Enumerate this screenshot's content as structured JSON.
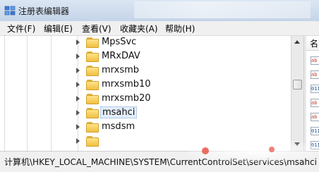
{
  "window": {
    "title": "注册表编辑器"
  },
  "menu": [
    "文件(F)",
    "编辑(E)",
    "查看(V)",
    "收藏夹(A)",
    "帮助(H)"
  ],
  "tree": {
    "items": [
      {
        "label": "MpsSvc",
        "selected": false
      },
      {
        "label": "MRxDAV",
        "selected": false
      },
      {
        "label": "mrxsmb",
        "selected": false
      },
      {
        "label": "mrxsmb10",
        "selected": false
      },
      {
        "label": "mrxsmb20",
        "selected": false
      },
      {
        "label": "msahci",
        "selected": true
      },
      {
        "label": "msdsm",
        "selected": false
      }
    ]
  },
  "values_pane": {
    "header_label": "名"
  },
  "status": {
    "path": "计算机\\HKEY_LOCAL_MACHINE\\SYSTEM\\CurrentControlSet\\services\\msahci"
  },
  "colors": {
    "selection": "#e3eefb",
    "folder": "#f0c040"
  }
}
